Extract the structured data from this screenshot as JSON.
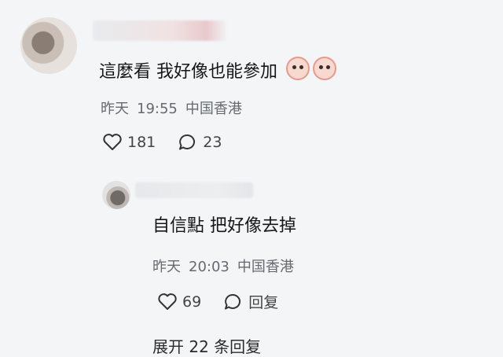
{
  "comments": [
    {
      "text": "這麼看 我好像也能參加",
      "emoji_count": 2,
      "meta": {
        "date": "昨天",
        "time": "19:55",
        "location": "中国香港"
      },
      "actions": {
        "likes": "181",
        "replies": "23"
      }
    }
  ],
  "reply": {
    "text": "自信點 把好像去掉",
    "meta": {
      "date": "昨天",
      "time": "20:03",
      "location": "中国香港"
    },
    "actions": {
      "likes": "69",
      "reply_label": "回复"
    }
  },
  "partial_row": {
    "text": "展开 22 条回复"
  }
}
